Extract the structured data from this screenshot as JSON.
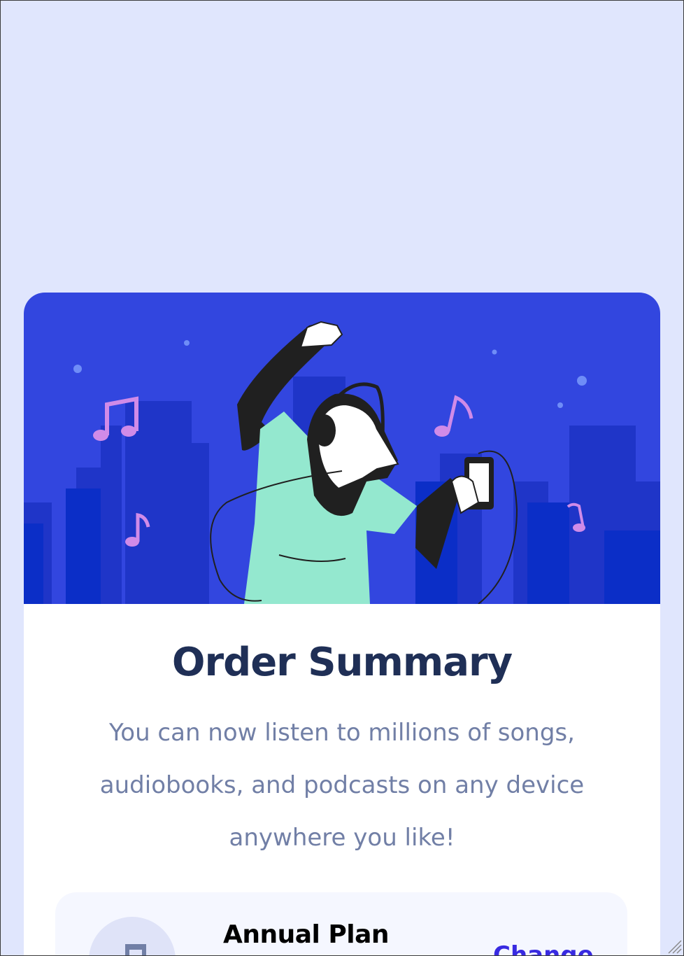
{
  "card": {
    "title": "Order Summary",
    "description": "You can now listen to millions of songs, audiobooks, and podcasts on any device anywhere you like!"
  },
  "plan": {
    "name": "Annual Plan",
    "change_label": "Change"
  },
  "colors": {
    "page_background": "#e0e6fd",
    "hero_background": "#3246df",
    "card_background": "#ffffff",
    "title": "#1f2f56",
    "description": "#717fa6",
    "plan_background": "#f5f7ff",
    "accent": "#382ae1"
  },
  "icons": {
    "hero": "dancing-person-with-headphones-illustration",
    "plan": "music-note-icon",
    "resize": "resize-grip-icon"
  }
}
